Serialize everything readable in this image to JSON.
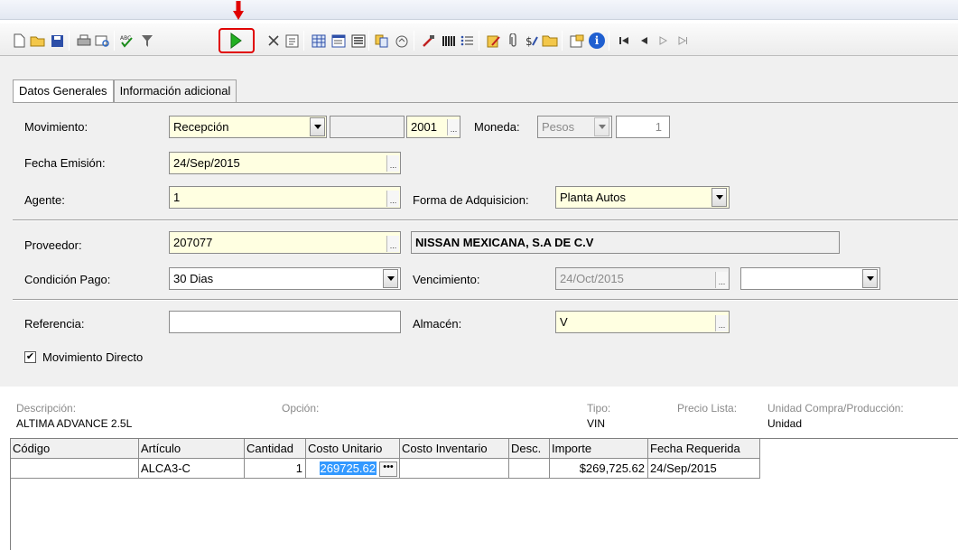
{
  "toolbar": {
    "icons": [
      "new-icon",
      "open-folder-icon",
      "save-icon",
      "print-icon",
      "print-preview-icon",
      "spellcheck-icon",
      "filter-icon",
      "run-icon",
      "delete-icon",
      "notes-icon",
      "grid-icon",
      "form-icon",
      "list-icon",
      "copy-icon",
      "link-icon",
      "cancel-icon",
      "columns-icon",
      "bullets-icon",
      "edit-icon",
      "attach-icon",
      "money-icon",
      "folder-icon",
      "properties-icon",
      "info-icon",
      "first-icon",
      "prev-icon",
      "next-icon",
      "last-icon"
    ]
  },
  "tabs": [
    "Datos Generales",
    "Información adicional"
  ],
  "form": {
    "movimiento_label": "Movimiento:",
    "movimiento_value": "Recepción",
    "movimiento_id": "2001",
    "moneda_label": "Moneda:",
    "moneda_value": "Pesos",
    "tipo_cambio": "1",
    "fecha_label": "Fecha Emisión:",
    "fecha_value": "24/Sep/2015",
    "agente_label": "Agente:",
    "agente_value": "1",
    "forma_label": "Forma de Adquisicion:",
    "forma_value": "Planta Autos",
    "proveedor_label": "Proveedor:",
    "proveedor_value": "207077",
    "proveedor_nombre": "NISSAN MEXICANA, S.A DE C.V",
    "condicion_label": "Condición Pago:",
    "condicion_value": "30 Dias",
    "vencimiento_label": "Vencimiento:",
    "vencimiento_value": "24/Oct/2015",
    "vencimiento_extra": "",
    "referencia_label": "Referencia:",
    "referencia_value": "",
    "almacen_label": "Almacén:",
    "almacen_value": "V",
    "directo_label": "Movimiento Directo",
    "directo_checked": "✔"
  },
  "info": {
    "descripcion_label": "Descripción:",
    "descripcion_value": "ALTIMA ADVANCE 2.5L",
    "opcion_label": "Opción:",
    "tipo_label": "Tipo:",
    "tipo_value": "VIN",
    "precio_label": "Precio Lista:",
    "unidad_label": "Unidad Compra/Producción:",
    "unidad_value": "Unidad"
  },
  "grid": {
    "headers": [
      "Código",
      "Artículo",
      "Cantidad",
      "Costo Unitario",
      "Costo Inventario",
      "Desc.",
      "Importe",
      "Fecha Requerida"
    ],
    "rows": [
      [
        "",
        "ALCA3-C",
        "1",
        "269725.62",
        "",
        "",
        "$269,725.62",
        "24/Sep/2015"
      ]
    ]
  },
  "colors": {
    "field_yellow": "#ffffe1",
    "highlight_red": "#e00000",
    "selection_blue": "#3399ff"
  }
}
